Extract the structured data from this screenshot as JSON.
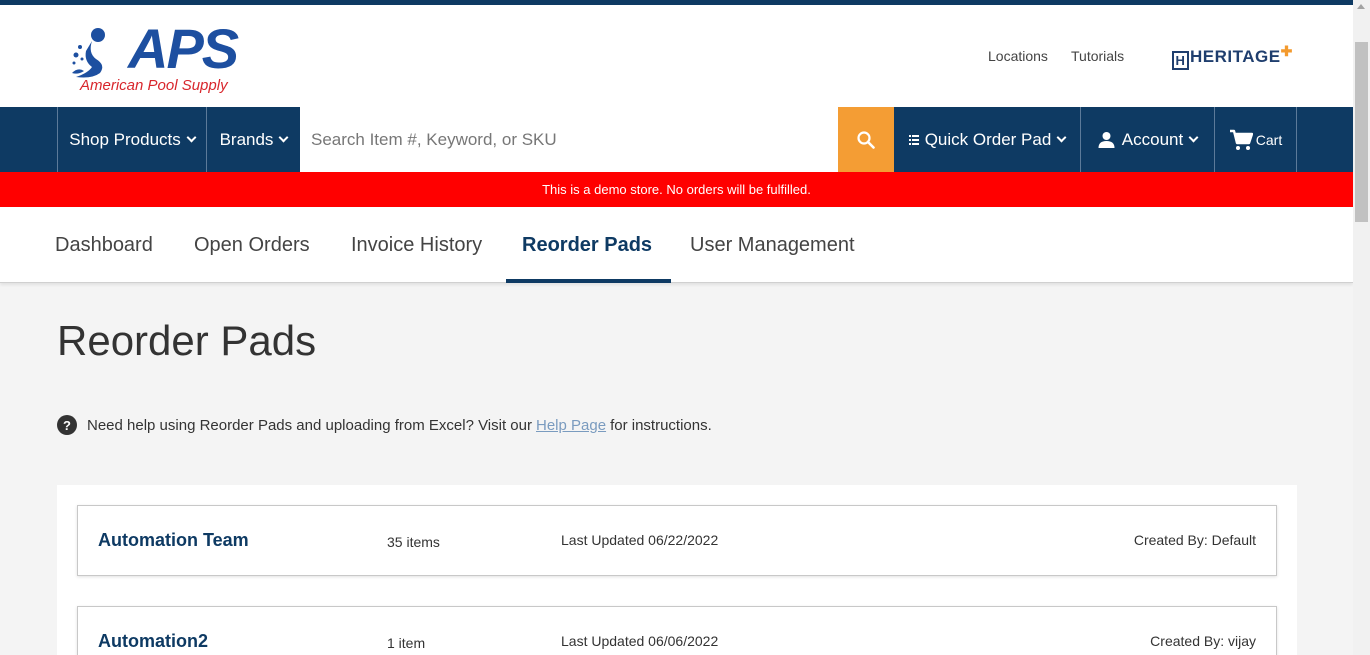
{
  "brand": {
    "logo_text": "APS",
    "logo_sub": "American Pool Supply",
    "partner_logo": "HERITAGE"
  },
  "header": {
    "links": [
      "Locations",
      "Tutorials"
    ]
  },
  "nav": {
    "shop_products": "Shop Products",
    "brands": "Brands",
    "search_placeholder": "Search Item #, Keyword, or SKU",
    "quick_order_pad": "Quick Order Pad",
    "account": "Account",
    "cart": "Cart"
  },
  "banner": {
    "text": "This is a demo store. No orders will be fulfilled."
  },
  "tabs": [
    {
      "label": "Dashboard"
    },
    {
      "label": "Open Orders"
    },
    {
      "label": "Invoice History"
    },
    {
      "label": "Reorder Pads",
      "active": true
    },
    {
      "label": "User Management"
    }
  ],
  "page": {
    "title": "Reorder Pads",
    "help_prefix": "Need help using Reorder Pads and uploading from Excel? Visit our",
    "help_link": "Help Page",
    "help_suffix": "for instructions."
  },
  "pads": [
    {
      "name": "Automation Team",
      "count": "35 items",
      "updated": "Last Updated 06/22/2022",
      "created": "Created By: Default"
    },
    {
      "name": "Automation2",
      "count": "1 item",
      "updated": "Last Updated 06/06/2022",
      "created": "Created By: vijay"
    }
  ],
  "colors": {
    "navy": "#0e3a63",
    "orange": "#f49d34",
    "banner_red": "#ff0000",
    "brand_blue": "#1d4fa0",
    "brand_red": "#d8262c"
  },
  "icons": {
    "search": "magnifier",
    "quick_order": "list-icon",
    "account": "person-icon",
    "cart": "cart-icon",
    "help": "question-circle-icon"
  }
}
